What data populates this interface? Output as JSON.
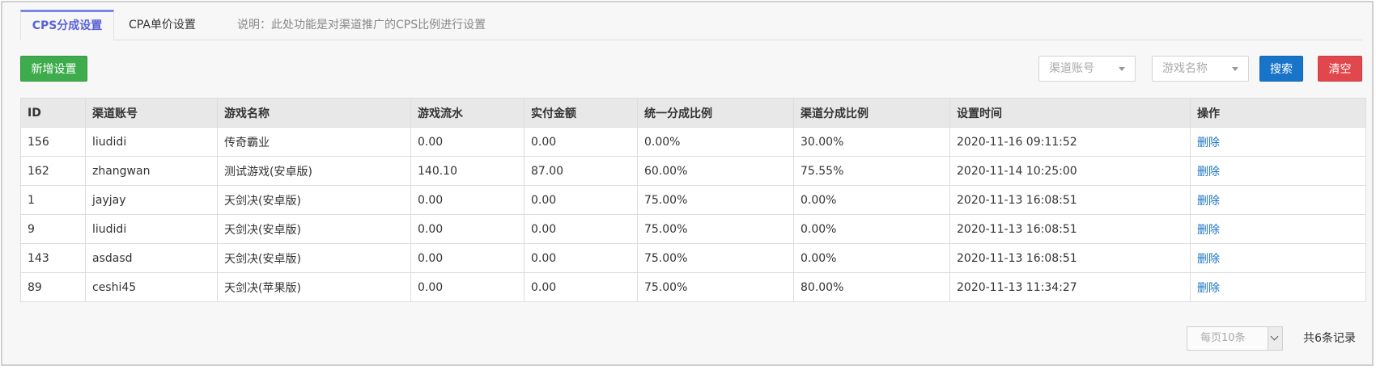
{
  "tabs": [
    {
      "label": "CPS分成设置",
      "active": true
    },
    {
      "label": "CPA单价设置",
      "active": false
    }
  ],
  "note": "说明：此处功能是对渠道推广的CPS比例进行设置",
  "toolbar": {
    "add_label": "新增设置",
    "channel_placeholder": "渠道账号",
    "game_placeholder": "游戏名称",
    "search_label": "搜索",
    "clear_label": "清空"
  },
  "colors": {
    "accent": "#5963d8",
    "add": "#3eac4c",
    "search": "#1874c8",
    "clear": "#e0484d",
    "link": "#1874c8"
  },
  "table": {
    "headers": [
      "ID",
      "渠道账号",
      "游戏名称",
      "游戏流水",
      "实付金额",
      "统一分成比例",
      "渠道分成比例",
      "设置时间",
      "操作"
    ],
    "rows": [
      [
        "156",
        "liudidi",
        "传奇霸业",
        "0.00",
        "0.00",
        "0.00%",
        "30.00%",
        "2020-11-16 09:11:52",
        "删除"
      ],
      [
        "162",
        "zhangwan",
        "测试游戏(安卓版)",
        "140.10",
        "87.00",
        "60.00%",
        "75.55%",
        "2020-11-14 10:25:00",
        "删除"
      ],
      [
        "1",
        "jayjay",
        "天剑决(安卓版)",
        "0.00",
        "0.00",
        "75.00%",
        "0.00%",
        "2020-11-13 16:08:51",
        "删除"
      ],
      [
        "9",
        "liudidi",
        "天剑决(安卓版)",
        "0.00",
        "0.00",
        "75.00%",
        "0.00%",
        "2020-11-13 16:08:51",
        "删除"
      ],
      [
        "143",
        "asdasd",
        "天剑决(安卓版)",
        "0.00",
        "0.00",
        "75.00%",
        "0.00%",
        "2020-11-13 16:08:51",
        "删除"
      ],
      [
        "89",
        "ceshi45",
        "天剑决(苹果版)",
        "0.00",
        "0.00",
        "75.00%",
        "80.00%",
        "2020-11-13 11:34:27",
        "删除"
      ]
    ]
  },
  "pager": {
    "page_size_label": "每页10条",
    "total_label": "共6条记录"
  }
}
